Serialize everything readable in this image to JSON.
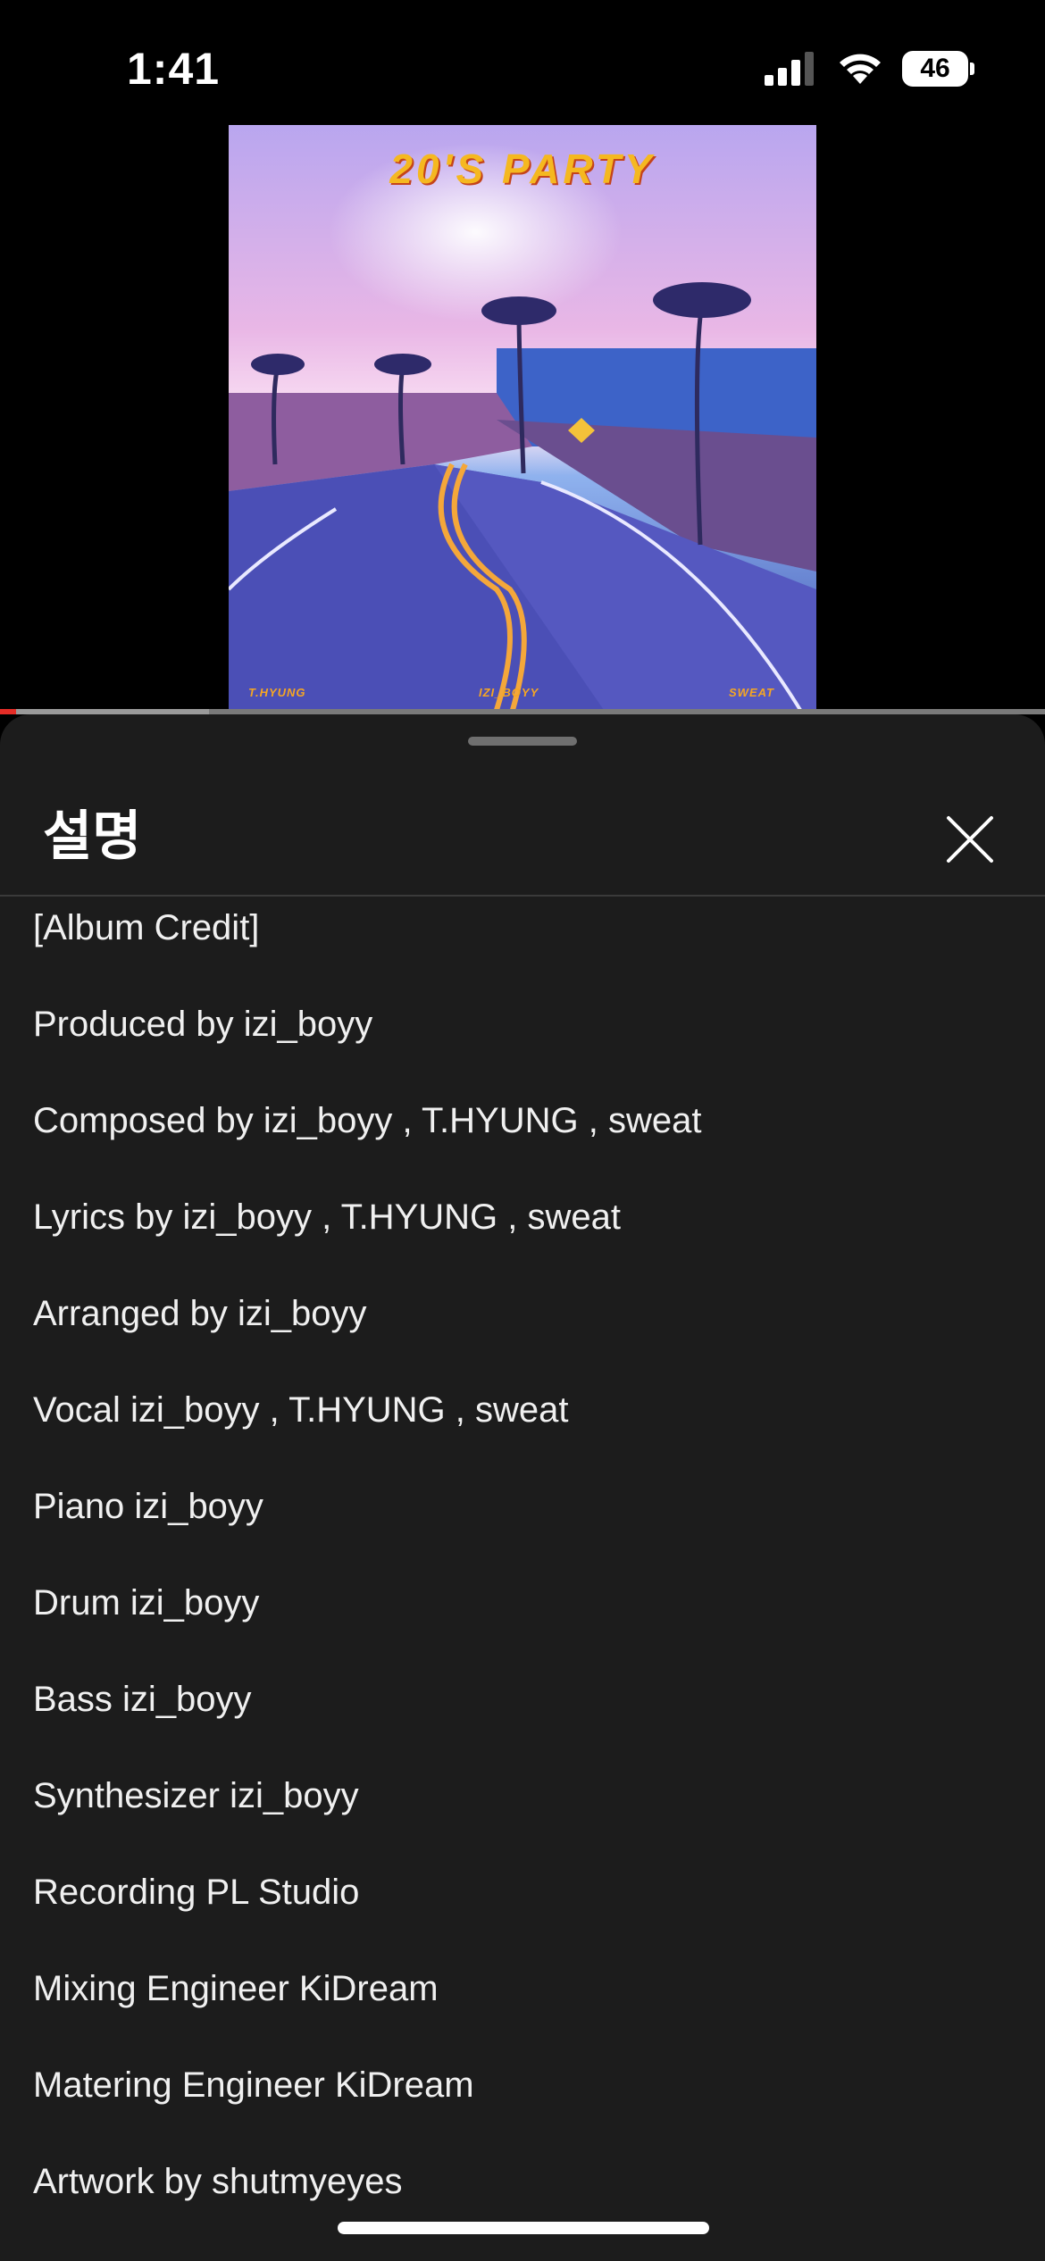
{
  "status_bar": {
    "time": "1:41",
    "battery": "46",
    "icons": [
      "signal-icon",
      "wifi-icon",
      "battery-icon"
    ]
  },
  "video": {
    "album_title": "20'S PARTY",
    "album_artists": [
      "T.HYUNG",
      "IZI_BOYY",
      "SWEAT"
    ],
    "progress_fraction": 0.015,
    "buffered_fraction": 0.2,
    "accent_color": "#e52d27"
  },
  "sheet": {
    "title": "설명",
    "close_icon": "close-icon",
    "credits": [
      "[Album Credit]",
      "Produced by izi_boyy",
      "Composed by izi_boyy , T.HYUNG , sweat",
      "Lyrics by izi_boyy , T.HYUNG , sweat",
      "Arranged by izi_boyy",
      "Vocal izi_boyy , T.HYUNG , sweat",
      "Piano izi_boyy",
      "Drum izi_boyy",
      "Bass izi_boyy",
      "Synthesizer izi_boyy",
      "Recording PL Studio",
      "Mixing Engineer KiDream",
      "Matering Engineer KiDream",
      "Artwork by shutmyeyes"
    ]
  },
  "colors": {
    "sheet_background": "#1c1c1c",
    "text": "#f0f0f0",
    "divider": "#3a3a3a"
  }
}
